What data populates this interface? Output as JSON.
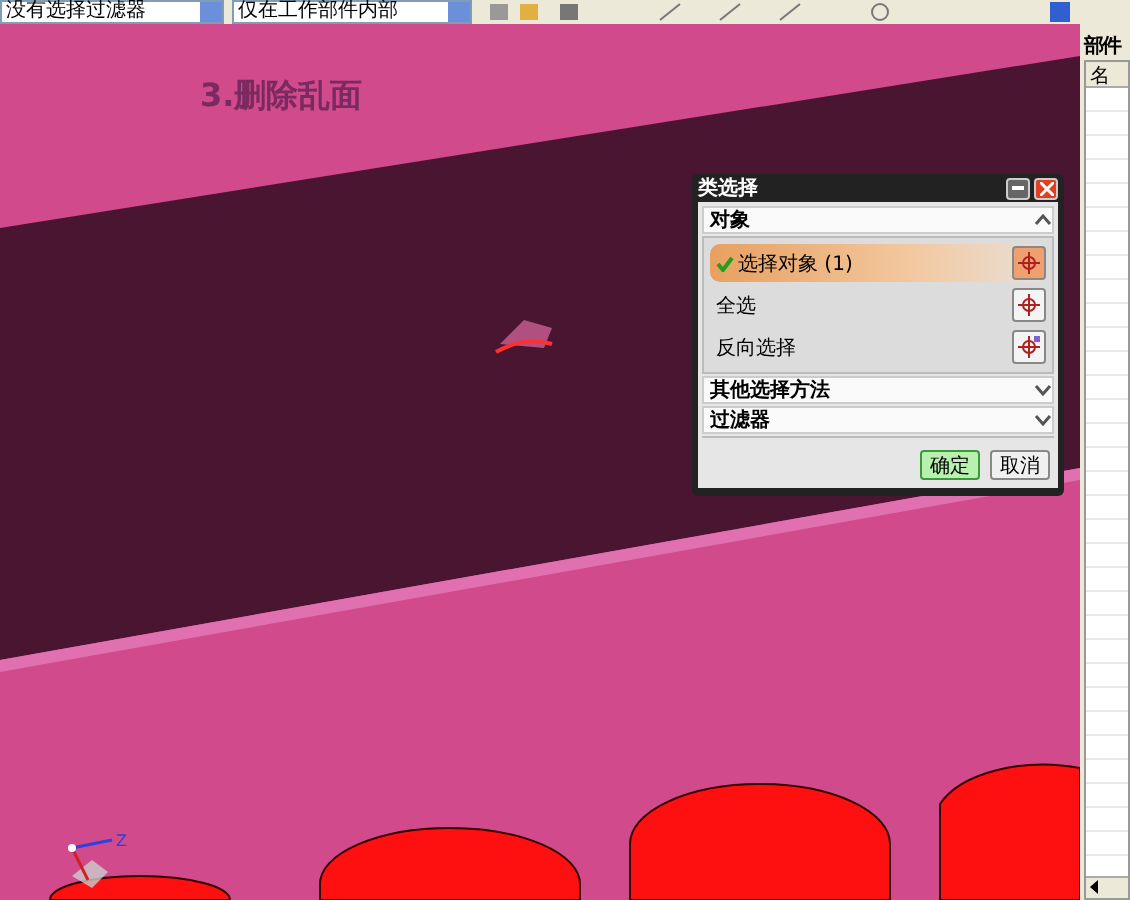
{
  "toolbar": {
    "dropdowns": [
      {
        "value": "没有选择过滤器"
      },
      {
        "value": "仅在工作部件内部"
      }
    ]
  },
  "canvas": {
    "title": "3.删除乱面",
    "axis_label": "Z"
  },
  "dialog": {
    "title": "类选择",
    "sections": [
      {
        "label": "对象",
        "expanded": true,
        "rows": [
          {
            "label": "选择对象 (1)",
            "selected": true,
            "checked": true,
            "kind": "select"
          },
          {
            "label": "全选",
            "selected": false,
            "checked": false,
            "kind": "all"
          },
          {
            "label": "反向选择",
            "selected": false,
            "checked": false,
            "kind": "invert"
          }
        ]
      },
      {
        "label": "其他选择方法",
        "expanded": false
      },
      {
        "label": "过滤器",
        "expanded": false
      }
    ],
    "buttons": [
      {
        "label": "确定",
        "primary": true
      },
      {
        "label": "取消",
        "primary": false
      }
    ]
  },
  "parts_panel": {
    "title": "部件",
    "columns": [
      "名"
    ]
  }
}
